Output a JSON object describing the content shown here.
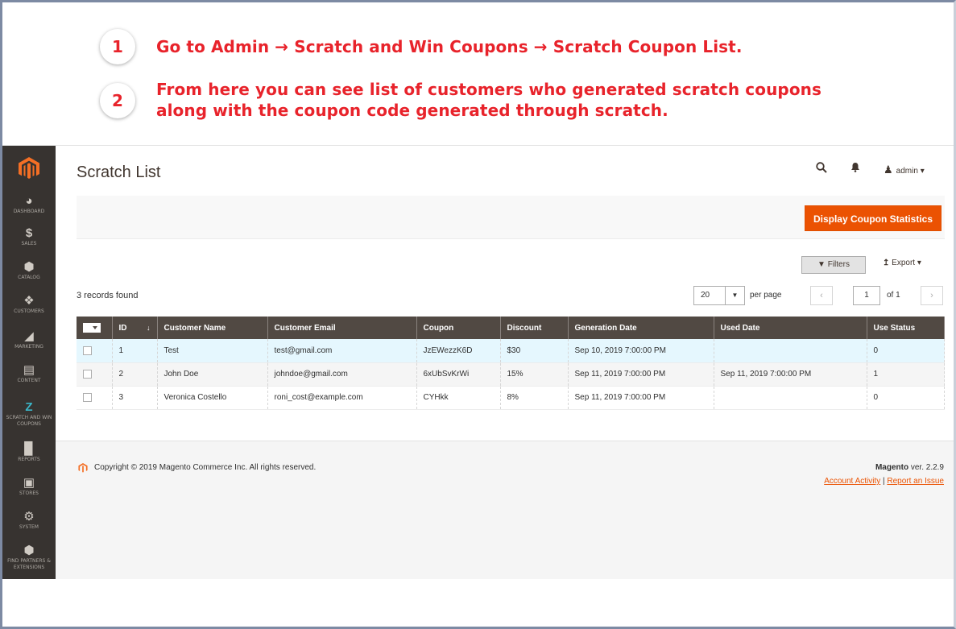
{
  "steps": [
    {
      "number": "1",
      "lines": [
        "Go to Admin  →  Scratch and Win Coupons  →  Scratch Coupon List."
      ]
    },
    {
      "number": "2",
      "lines": [
        "From here you can see list of customers who generated scratch coupons",
        "along with the coupon code generated through scratch."
      ]
    }
  ],
  "sidebar": {
    "items": [
      {
        "label": "DASHBOARD",
        "icon": "dashboard-icon"
      },
      {
        "label": "SALES",
        "icon": "dollar-icon"
      },
      {
        "label": "CATALOG",
        "icon": "cube-icon"
      },
      {
        "label": "CUSTOMERS",
        "icon": "person-icon"
      },
      {
        "label": "MARKETING",
        "icon": "megaphone-icon"
      },
      {
        "label": "CONTENT",
        "icon": "layout-icon"
      },
      {
        "label": "SCRATCH AND WIN COUPONS",
        "icon": "z-icon"
      },
      {
        "label": "REPORTS",
        "icon": "bar-chart-icon"
      },
      {
        "label": "STORES",
        "icon": "store-icon"
      },
      {
        "label": "SYSTEM",
        "icon": "gear-icon"
      },
      {
        "label": "FIND PARTNERS & EXTENSIONS",
        "icon": "box-icon"
      }
    ]
  },
  "header": {
    "title": "Scratch List",
    "user": "admin"
  },
  "actions": {
    "primary_label": "Display Coupon Statistics",
    "filters_label": "Filters",
    "export_label": "Export"
  },
  "grid": {
    "records": "3 records found",
    "per_page": "20",
    "per_page_label": "per page",
    "page": "1",
    "of_label": "of 1",
    "columns": [
      "ID",
      "Customer Name",
      "Customer Email",
      "Coupon",
      "Discount",
      "Generation Date",
      "Used Date",
      "Use Status"
    ],
    "rows": [
      [
        "1",
        "Test",
        "test@gmail.com",
        "JzEWezzK6D",
        "$30",
        "Sep 10, 2019 7:00:00 PM",
        "",
        "0"
      ],
      [
        "2",
        "John Doe",
        "johndoe@gmail.com",
        "6xUbSvKrWi",
        "15%",
        "Sep 11, 2019 7:00:00 PM",
        "Sep 11, 2019 7:00:00 PM",
        "1"
      ],
      [
        "3",
        "Veronica Costello",
        "roni_cost@example.com",
        "CYHkk",
        "8%",
        "Sep 11, 2019 7:00:00 PM",
        "",
        "0"
      ]
    ]
  },
  "footer": {
    "copyright": "Copyright © 2019 Magento Commerce Inc. All rights reserved.",
    "brand": "Magento",
    "version": " ver. 2.2.9",
    "link_activity": "Account Activity",
    "separator": " | ",
    "link_issue": "Report an Issue"
  },
  "colors": {
    "step_red": "#e8232b",
    "sidebar_bg": "#373330",
    "accent_orange": "#eb5202",
    "grid_header": "#514943"
  }
}
